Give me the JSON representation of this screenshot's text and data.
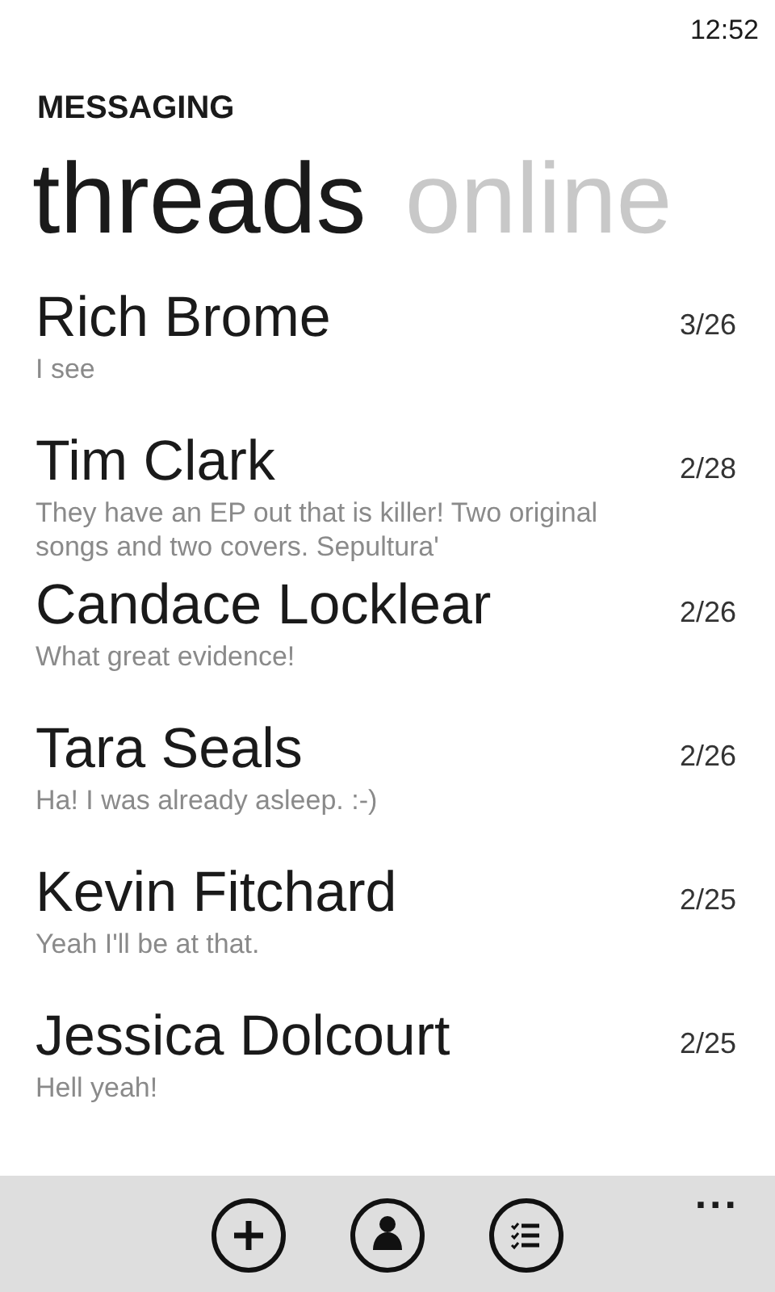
{
  "status_bar": {
    "time": "12:52"
  },
  "app_title": "MESSAGING",
  "pivots": [
    {
      "label": "threads",
      "selected": true
    },
    {
      "label": "online",
      "selected": false
    }
  ],
  "threads": [
    {
      "name": "Rich Brome",
      "preview": "I see",
      "date": "3/26"
    },
    {
      "name": "Tim Clark",
      "preview": "They have an EP out that is killer! Two original songs and two covers. Sepultura'",
      "date": "2/28"
    },
    {
      "name": "Candace Locklear",
      "preview": "What great evidence!",
      "date": "2/26"
    },
    {
      "name": "Tara Seals",
      "preview": "Ha! I was already asleep. :-)",
      "date": "2/26"
    },
    {
      "name": "Kevin Fitchard",
      "preview": "Yeah I'll be at that.",
      "date": "2/25"
    },
    {
      "name": "Jessica Dolcourt",
      "preview": "Hell yeah!",
      "date": "2/25"
    }
  ],
  "app_bar": {
    "buttons": [
      {
        "kind": "add"
      },
      {
        "kind": "contact"
      },
      {
        "kind": "list"
      }
    ],
    "more": "..."
  }
}
